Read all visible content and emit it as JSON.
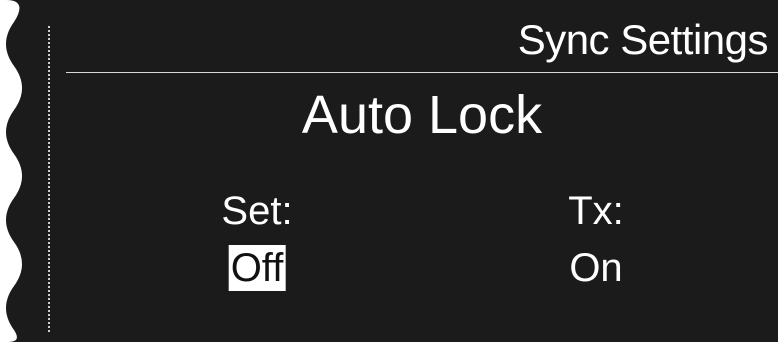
{
  "header": {
    "title": "Sync Settings"
  },
  "page": {
    "title": "Auto Lock"
  },
  "settings": {
    "set": {
      "label": "Set:",
      "value": "Off",
      "selected": true
    },
    "tx": {
      "label": "Tx:",
      "value": "On"
    }
  },
  "colors": {
    "background": "#1b1b1b",
    "text": "#ffffff",
    "selection_bg": "#ffffff",
    "selection_text": "#111111",
    "frame": "#ffffff"
  }
}
